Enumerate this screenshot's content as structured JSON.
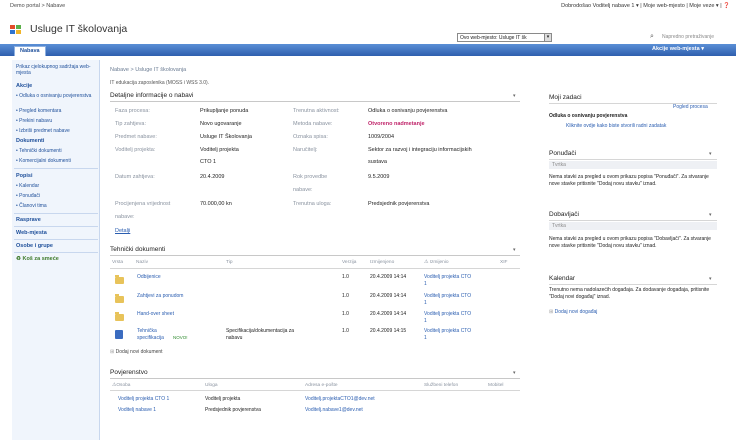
{
  "topbar": {
    "breadcrumb": "Demo portal > Nabave",
    "welcome": "Dobrodošao Voditelj nabave 1 ▾ | Moje web-mjesto | Moje veze ▾ | ❓"
  },
  "site": {
    "title": "Usluge IT školovanja",
    "search_scope": "Ovo web-mjesto: Usluge IT šk",
    "search_placeholder": "Napredno pretraživanje"
  },
  "nav": {
    "tab": "Nabava",
    "actions": "Akcije web-mjesta ▾"
  },
  "sidebar": {
    "view_all": "Prikaz cjelokupnog sadržaja web-mjesta",
    "groups": [
      {
        "head": "Akcije",
        "items": [
          "Odluka o osnivanju povjerenstva",
          "Pregled komentara",
          "Prekini nabavu",
          "Izbriši predmet nabave"
        ]
      },
      {
        "head": "Dokumenti",
        "items": [
          "Tehnički dokumenti",
          "Komercijalni dokumenti"
        ]
      },
      {
        "head": "Popisi",
        "items": [
          "Kalendar",
          "Ponuđači",
          "Članovi tima"
        ]
      },
      {
        "head": "Rasprave",
        "items": []
      },
      {
        "head": "Web-mjesta",
        "items": []
      },
      {
        "head": "Osobe i grupe",
        "items": []
      }
    ],
    "recycle": "Koš za smeće"
  },
  "main": {
    "breadcrumb": "Nabave > Usluge IT školovanja",
    "subtitle": "IT edukacija zaposlenika (MOSS i WSS 3.0).",
    "details": {
      "title": "Detaljne informacije o nabavi",
      "left": [
        {
          "label": "Faza procesa:",
          "value": "Prikupljanje ponuda"
        },
        {
          "label": "Tip zahtjeva:",
          "value": "Novo ugovaranje"
        },
        {
          "label": "Predmet nabave:",
          "value": "Usluge IT Školovanja"
        },
        {
          "label": "Voditelj projekta:",
          "value": "Voditelj projekta"
        },
        {
          "label": "",
          "value": "CTO 1"
        },
        {
          "label": "Datum zahtjeva:",
          "value": "20.4.2009"
        },
        {
          "label": "Procijenjena vrijednost",
          "value": "70.000,00 kn"
        },
        {
          "label": "nabave:",
          "value": ""
        }
      ],
      "right": [
        {
          "label": "Trenutna aktivnost:",
          "value": "Odluka o osnivanju povjerenstva"
        },
        {
          "label": "Metoda nabave:",
          "value": "Otvoreno nadmetanje"
        },
        {
          "label": "Oznaka spisa:",
          "value": "1009/2004"
        },
        {
          "label": "Naručitelj:",
          "value": "Sektor za razvoj i integraciju informacijskih"
        },
        {
          "label": "",
          "value": "sustava"
        },
        {
          "label": "Rok provedbe",
          "value": "9.5.2009"
        },
        {
          "label": "nabave:",
          "value": ""
        },
        {
          "label": "Trenutna uloga:",
          "value": "Predsjednik povjerenstva"
        }
      ],
      "details_link": "Detalji"
    },
    "tech_docs": {
      "title": "Tehnički dokumenti",
      "columns": [
        "Vrsta",
        "Naziv",
        "Tip",
        "Verzija",
        "Izmijenjeno",
        "Izmijenio",
        "XIF"
      ],
      "rows": [
        {
          "name": "Odbijenice",
          "type": "",
          "version": "1.0",
          "modified": "20.4.2009 14:14",
          "by": "Voditelj projekta CTO",
          "by2": "1",
          "icon": "folder"
        },
        {
          "name": "Zahtjevi za ponudom",
          "type": "",
          "version": "1.0",
          "modified": "20.4.2009 14:14",
          "by": "Voditelj projekta CTO",
          "by2": "1",
          "icon": "folder"
        },
        {
          "name": "Hand-over sheet",
          "type": "",
          "version": "1.0",
          "modified": "20.4.2009 14:14",
          "by": "Voditelj projekta CTO",
          "by2": "1",
          "icon": "folder"
        },
        {
          "name": "Tehnička",
          "name2": "specifikacija",
          "badge": "NOVO!",
          "type": "Specifikacija/dokumentacija za",
          "type2": "nabavu",
          "version": "1.0",
          "modified": "20.4.2009 14:15",
          "by": "Voditelj projekta CTO",
          "by2": "1",
          "icon": "doc"
        }
      ],
      "add": "Dodaj novi dokument"
    },
    "committee": {
      "title": "Povjerenstvo",
      "columns": [
        "Osoba",
        "Uloga",
        "Adresa e-pošte",
        "Službeni telefon",
        "Mobitel"
      ],
      "rows": [
        {
          "person": "Voditelj projekta CTO 1",
          "role": "Voditelj projekta",
          "email": "Voditelj.projektaCTO1@dev.net"
        },
        {
          "person": "Voditelj nabave 1",
          "role": "Predsjednik povjerenstva",
          "email": "Voditelj.nabave1@dev.net"
        }
      ]
    }
  },
  "right": {
    "tasks": {
      "title": "Moji zadaci",
      "overview": "Pogled procesa",
      "task": "Odluka o osnivanju povjerenstva",
      "hint": "Kliknite ovdje kako biste stvorili radni zadatak"
    },
    "bidders": {
      "title": "Ponuđači",
      "field": "Tvrtka",
      "text": "Nema stavki za pregled u ovom prikazu popisa \"Ponuđači\". Za stvaranje nove stavke pritisnite \"Dodaj novu stavku\" iznad."
    },
    "suppliers": {
      "title": "Dobavljači",
      "field": "Tvrtka",
      "text": "Nema stavki za pregled u ovom prikazu popisa \"Dobavljači\". Za stvaranje nove stavke pritisnite \"Dodaj novu stavku\" iznad."
    },
    "calendar": {
      "title": "Kalendar",
      "text": "Trenutno nema nadolazećih događaja. Za dodavanje događaja, pritisnite \"Dodaj novi događaj\" iznad.",
      "add": "Dodaj novi događaj"
    }
  },
  "colors": {
    "nav_blue": "#2f5fae",
    "accent_magenta": "#c0246a",
    "link_blue": "#2a5db0"
  }
}
